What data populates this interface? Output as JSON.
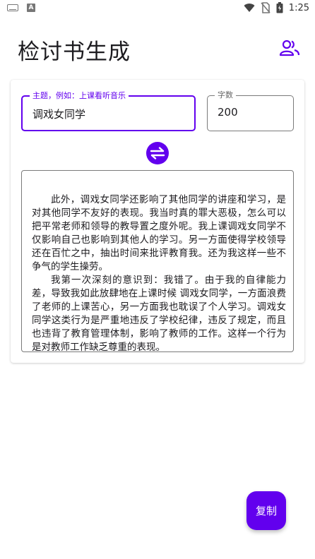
{
  "status_bar": {
    "time": "1:25",
    "icons": [
      "keyboard-icon",
      "a-badge-icon",
      "wifi-icon",
      "no-sim-icon",
      "battery-icon"
    ]
  },
  "app_bar": {
    "title": "检讨书生成",
    "action_icon": "people-icon"
  },
  "form": {
    "topic": {
      "label": "主题，例如：上课看听音乐",
      "value": "调戏女同学"
    },
    "word_count": {
      "label": "字数",
      "value": "200"
    },
    "swap_icon": "swap-icon"
  },
  "essay": {
    "paragraph_1": "此外，调戏女同学还影响了其他同学的讲座和学习，是对其他同学不友好的表现。我当时真的罪大恶极，怎么可以把平常老师和领导的教导置之度外呢。我上课调戏女同学不仅影响自己也影响到其他人的学习。另一方面使得学校领导还在百忙之中，抽出时间来批评教育我。还为我这样一些不争气的学生操劳。",
    "paragraph_2": "我第一次深刻的意识到：我错了。由于我的自律能力差，导致我如此放肆地在上课时候 调戏女同学，一方面浪费了老师的上课苦心，另一方面我也耽误了个人学习。调戏女同学这类行为是严重地违反了学校纪律，违反了规定，而且也违背了教育管理体制，影响了教师的工作。这样一个行为是对教师工作缺乏尊重的表现。"
  },
  "fab": {
    "label": "复制"
  },
  "colors": {
    "accent": "#6200ee",
    "outline": "#7a7a7a"
  }
}
